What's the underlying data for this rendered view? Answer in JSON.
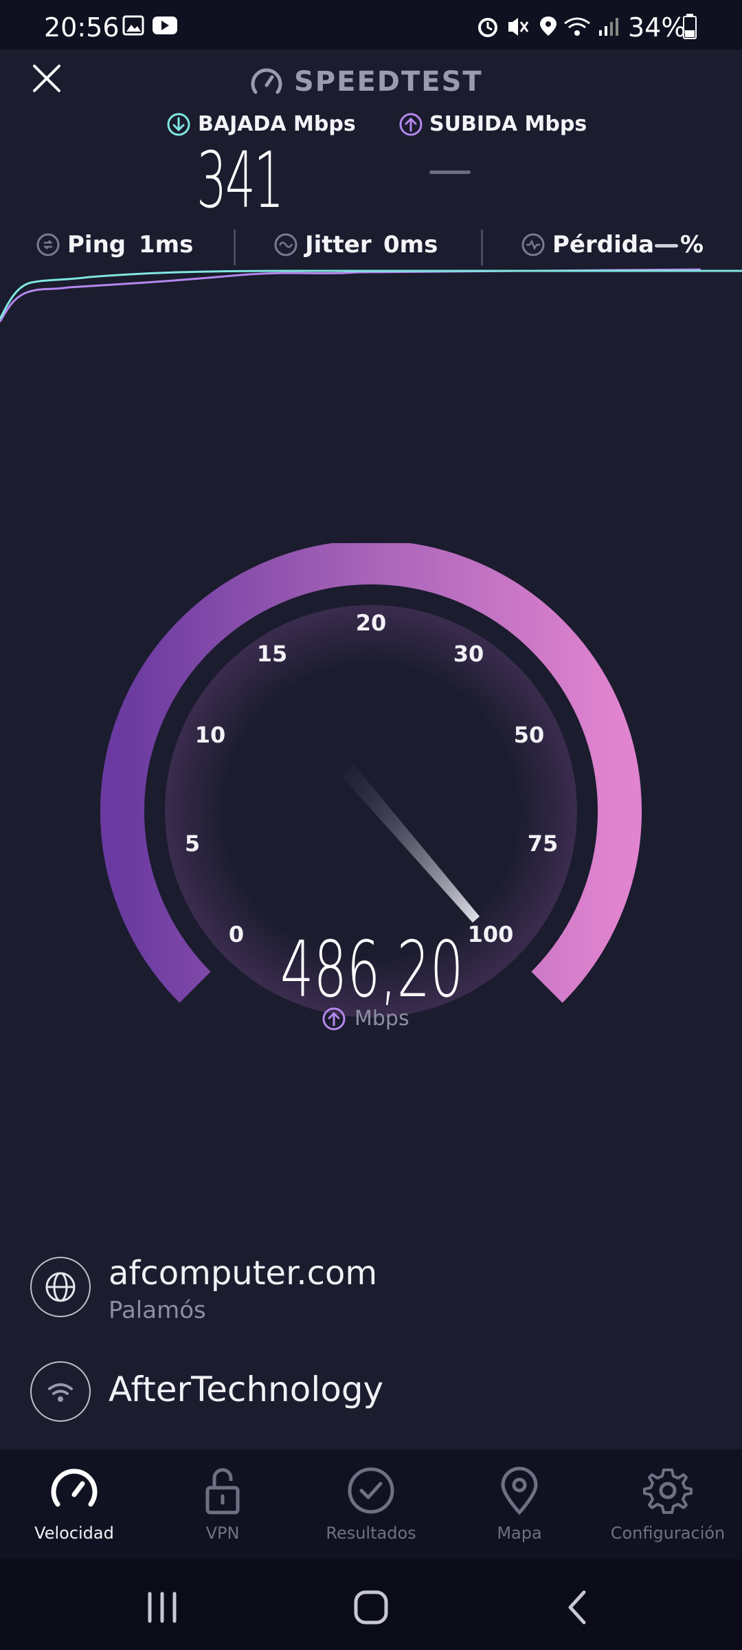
{
  "status_bar": {
    "time": "20:56",
    "battery": "34%"
  },
  "header": {
    "title": "SPEEDTEST"
  },
  "metrics": {
    "download_label": "BAJADA Mbps",
    "upload_label": "SUBIDA Mbps",
    "download_value": "341"
  },
  "stats": {
    "ping_label": "Ping",
    "ping_value": "1ms",
    "jitter_label": "Jitter",
    "jitter_value": "0ms",
    "loss_label": "Pérdida",
    "loss_unit": "%"
  },
  "gauge": {
    "ticks": [
      "0",
      "5",
      "10",
      "15",
      "20",
      "30",
      "50",
      "75",
      "100"
    ],
    "value": "486,20",
    "unit": "Mbps"
  },
  "server": {
    "name": "afcomputer.com",
    "location": "Palamós"
  },
  "provider": {
    "name": "AfterTechnology"
  },
  "nav": {
    "items": [
      {
        "label": "Velocidad",
        "icon": "speedometer-icon"
      },
      {
        "label": "VPN",
        "icon": "lock-icon"
      },
      {
        "label": "Resultados",
        "icon": "check-circle-icon"
      },
      {
        "label": "Mapa",
        "icon": "map-pin-icon"
      },
      {
        "label": "Configuración",
        "icon": "gear-icon"
      }
    ]
  },
  "colors": {
    "background": "#1b1c2e",
    "download_accent": "#7fe7e1",
    "upload_accent": "#b488ee",
    "gauge_start": "#6a3aa0",
    "gauge_end": "#e184cf"
  }
}
